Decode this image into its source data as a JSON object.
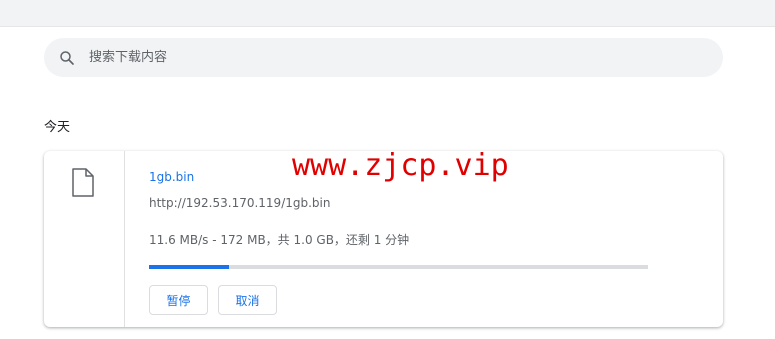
{
  "search": {
    "placeholder": "搜索下载内容",
    "icon": "search-icon"
  },
  "section": {
    "title": "今天"
  },
  "download": {
    "file_icon": "file-icon",
    "file_name": "1gb.bin",
    "url": "http://192.53.170.119/1gb.bin",
    "status": "11.6 MB/s - 172 MB，共 1.0 GB，还剩 1 分钟",
    "progress": 0.16,
    "pause_label": "暂停",
    "cancel_label": "取消"
  },
  "watermark": {
    "text": "www.zjcp.vip"
  },
  "colors": {
    "accent": "#1a73e8",
    "watermark": "#e00000"
  }
}
